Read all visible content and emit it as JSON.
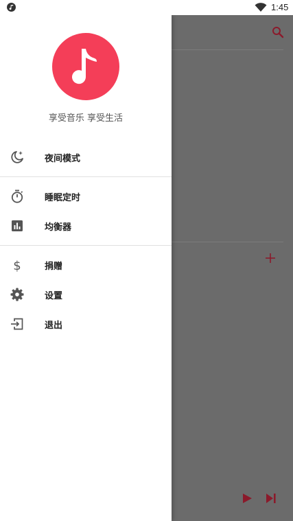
{
  "status_bar": {
    "time": "1:45",
    "left_icon": "music-note-notification-icon",
    "wifi_icon": "wifi-icon"
  },
  "drawer": {
    "logo_icon": "music-note-icon",
    "logo_color": "#f43e58",
    "slogan": "享受音乐 享受生活",
    "groups": [
      {
        "items": [
          {
            "label": "夜间模式",
            "icon": "night-mode-icon"
          }
        ]
      },
      {
        "items": [
          {
            "label": "睡眠定时",
            "icon": "timer-icon"
          },
          {
            "label": "均衡器",
            "icon": "equalizer-icon"
          }
        ]
      },
      {
        "items": [
          {
            "label": "捐赠",
            "icon": "dollar-icon"
          },
          {
            "label": "设置",
            "icon": "gear-icon"
          },
          {
            "label": "退出",
            "icon": "exit-icon"
          }
        ]
      }
    ]
  },
  "background_app": {
    "accent_color": "#8b1a2b",
    "icons": [
      "search-icon",
      "add-icon",
      "play-icon",
      "skip-next-icon"
    ]
  }
}
